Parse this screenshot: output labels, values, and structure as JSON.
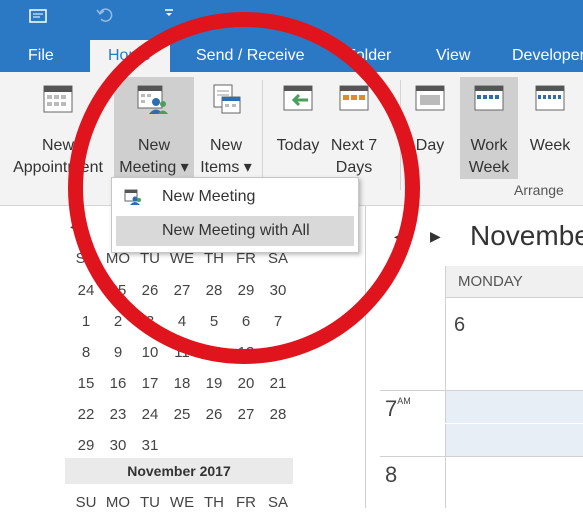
{
  "tabs": [
    "File",
    "Home",
    "Send / Receive",
    "Folder",
    "View",
    "Developer"
  ],
  "ribbon": {
    "new_appointment": [
      "New",
      "Appointment"
    ],
    "new_meeting": [
      "New",
      "Meeting ▾"
    ],
    "new_items": [
      "New",
      "Items ▾"
    ],
    "today": "Today",
    "next_days": [
      "Next 7",
      "Days"
    ],
    "day": "Day",
    "work_week": [
      "Work",
      "Week"
    ],
    "week": "Week",
    "arrange_group": "Arrange"
  },
  "dropdown": {
    "item1": "New Meeting",
    "item2": "New Meeting with All"
  },
  "mini_calendar": {
    "weekdays": [
      "SU",
      "MO",
      "TU",
      "WE",
      "TH",
      "FR",
      "SA"
    ],
    "weeks": [
      [
        "24",
        "25",
        "26",
        "27",
        "28",
        "29",
        "30"
      ],
      [
        "1",
        "2",
        "3",
        "4",
        "5",
        "6",
        "7"
      ],
      [
        "8",
        "9",
        "10",
        "11",
        "12",
        "13",
        "14"
      ],
      [
        "15",
        "16",
        "17",
        "18",
        "19",
        "20",
        "21"
      ],
      [
        "22",
        "23",
        "24",
        "25",
        "26",
        "27",
        "28"
      ],
      [
        "29",
        "30",
        "31",
        "",
        "",
        "",
        ""
      ]
    ],
    "next_month_title": "November 2017",
    "next_weekdays": [
      "SU",
      "MO",
      "TU",
      "WE",
      "TH",
      "FR",
      "SA"
    ]
  },
  "main_view": {
    "month_title": "Novembe",
    "day_header": "MONDAY",
    "day_number": "6",
    "hours": [
      {
        "h": "7",
        "suffix": "AM"
      },
      {
        "h": "8",
        "suffix": ""
      }
    ]
  },
  "colors": {
    "accent": "#2b78c5",
    "circle": "#e0141c"
  }
}
